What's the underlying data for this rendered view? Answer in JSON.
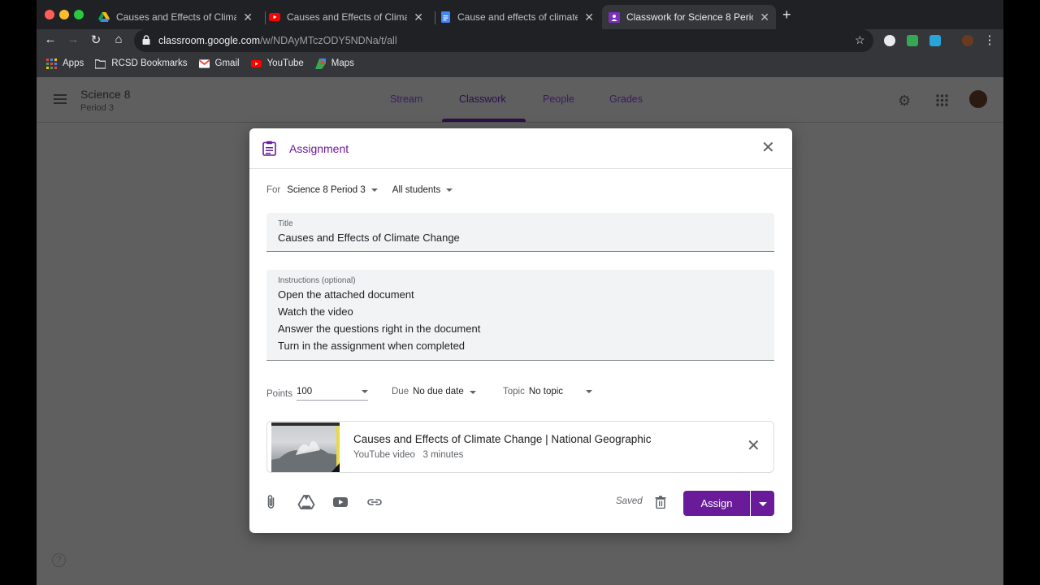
{
  "browser": {
    "tabs": [
      {
        "title": "Causes and Effects of Climate",
        "favicon": "google-drive-icon"
      },
      {
        "title": "Causes and Effects of Climate",
        "favicon": "youtube-icon"
      },
      {
        "title": "Cause and effects of climate c",
        "favicon": "google-docs-icon"
      },
      {
        "title": "Classwork for Science 8 Period",
        "favicon": "google-classroom-icon"
      }
    ],
    "url_host": "classroom.google.com",
    "url_path": "/w/NDAyMTczODY5NDNa/t/all",
    "bookmarks": [
      "Apps",
      "RCSD Bookmarks",
      "Gmail",
      "YouTube",
      "Maps"
    ]
  },
  "classroom": {
    "class_name": "Science 8",
    "section": "Period 3",
    "tabs": [
      "Stream",
      "Classwork",
      "People",
      "Grades"
    ],
    "active_tab": "Classwork"
  },
  "dialog": {
    "type_label": "Assignment",
    "for_label": "For",
    "class_select": "Science 8 Period 3",
    "students_select": "All students",
    "title_label": "Title",
    "title_value": "Causes and Effects of Climate Change",
    "instructions_label": "Instructions (optional)",
    "instructions": [
      "Open the attached document",
      "Watch the video",
      "Answer the questions right in the document",
      "Turn in the assignment when completed"
    ],
    "points_label": "Points",
    "points_value": "100",
    "due_label": "Due",
    "due_value": "No due date",
    "topic_label": "Topic",
    "topic_value": "No topic",
    "attachment": {
      "title": "Causes and Effects of Climate Change | National Geographic",
      "kind": "YouTube video",
      "duration": "3 minutes"
    },
    "saved_label": "Saved",
    "assign_label": "Assign"
  },
  "colors": {
    "accent": "#6a1b9a",
    "overlay": "#5f5f5f",
    "chrome_dark": "#202124"
  }
}
